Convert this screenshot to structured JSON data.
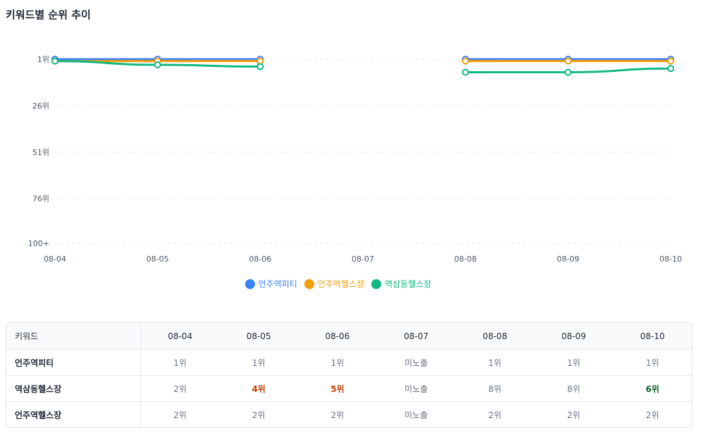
{
  "title": "키워드별 순위 추이",
  "chart_data": {
    "type": "line",
    "x": [
      "08-04",
      "08-05",
      "08-06",
      "08-07",
      "08-08",
      "08-09",
      "08-10"
    ],
    "y_ticks": [
      "1위",
      "26위",
      "51위",
      "76위",
      "100+"
    ],
    "y_tick_values": [
      1,
      26,
      51,
      76,
      100
    ],
    "ylim": [
      1,
      100
    ],
    "y_inverted": true,
    "grid": true,
    "legend_position": "bottom",
    "series": [
      {
        "name": "언주역피티",
        "color": "#3b82f6",
        "values": [
          1,
          1,
          1,
          null,
          1,
          1,
          1
        ]
      },
      {
        "name": "언주역헬스장",
        "color": "#f59e0b",
        "values": [
          2,
          2,
          2,
          null,
          2,
          2,
          2
        ]
      },
      {
        "name": "역삼동헬스장",
        "color": "#10b981",
        "values": [
          2,
          4,
          5,
          null,
          8,
          8,
          6
        ]
      }
    ]
  },
  "table": {
    "header_keyword": "키워드",
    "dates": [
      "08-04",
      "08-05",
      "08-06",
      "08-07",
      "08-08",
      "08-09",
      "08-10"
    ],
    "rows": [
      {
        "keyword": "언주역피티",
        "cells": [
          {
            "text": "1위",
            "state": "val"
          },
          {
            "text": "1위",
            "state": "val"
          },
          {
            "text": "1위",
            "state": "val"
          },
          {
            "text": "미노출",
            "state": "missing"
          },
          {
            "text": "1위",
            "state": "val"
          },
          {
            "text": "1위",
            "state": "val"
          },
          {
            "text": "1위",
            "state": "val"
          }
        ]
      },
      {
        "keyword": "역삼동헬스장",
        "cells": [
          {
            "text": "2위",
            "state": "val"
          },
          {
            "text": "4위",
            "state": "up"
          },
          {
            "text": "5위",
            "state": "up"
          },
          {
            "text": "미노출",
            "state": "missing"
          },
          {
            "text": "8위",
            "state": "val"
          },
          {
            "text": "8위",
            "state": "val"
          },
          {
            "text": "6위",
            "state": "down"
          }
        ]
      },
      {
        "keyword": "언주역헬스장",
        "cells": [
          {
            "text": "2위",
            "state": "val"
          },
          {
            "text": "2위",
            "state": "val"
          },
          {
            "text": "2위",
            "state": "val"
          },
          {
            "text": "미노출",
            "state": "missing"
          },
          {
            "text": "2위",
            "state": "val"
          },
          {
            "text": "2위",
            "state": "val"
          },
          {
            "text": "2위",
            "state": "val"
          }
        ]
      }
    ]
  }
}
